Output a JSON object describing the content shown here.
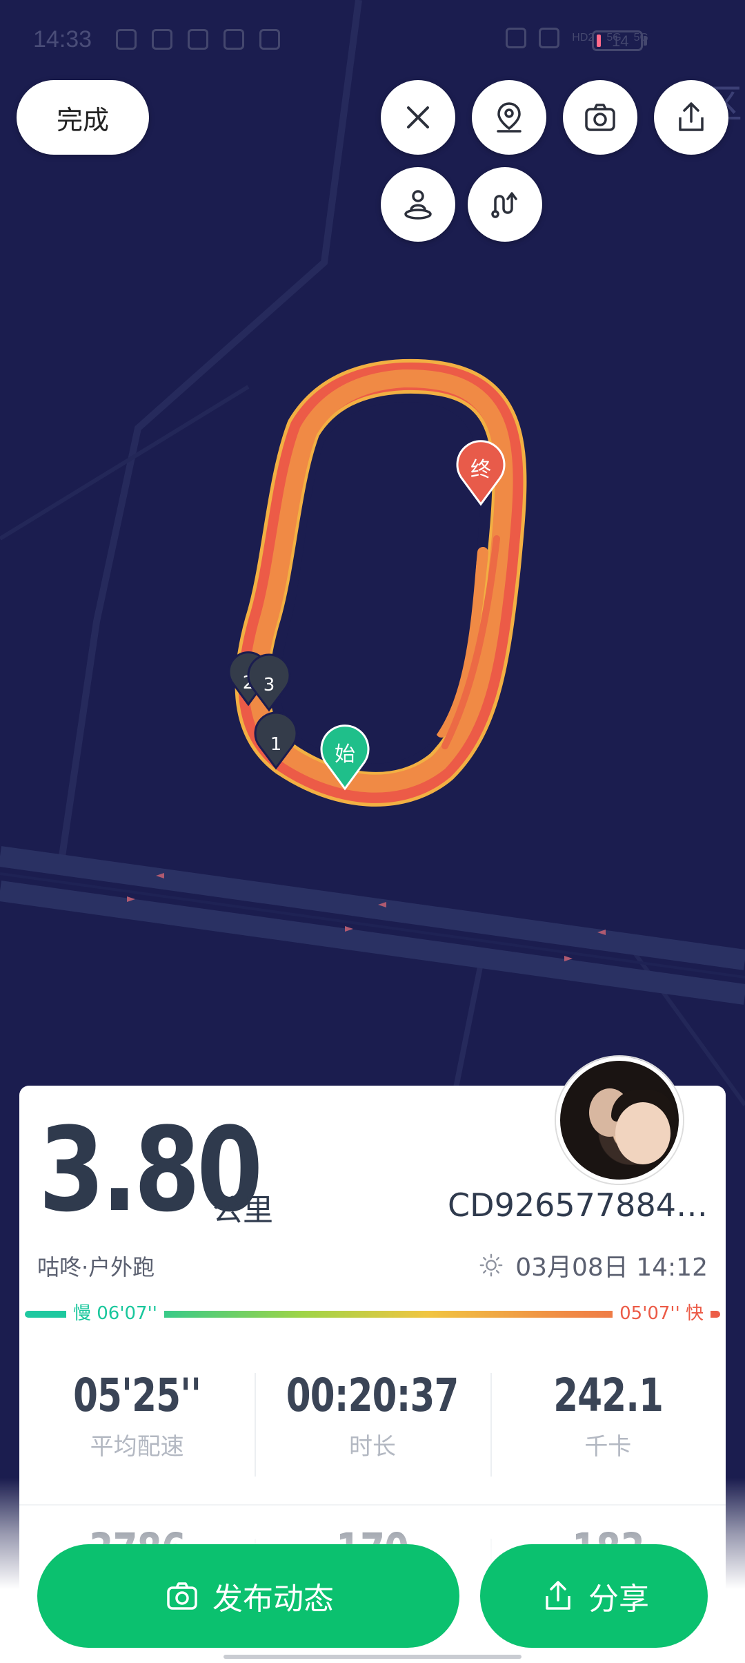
{
  "status_bar": {
    "time": "14:33",
    "network_labels": [
      "HD2",
      "5G",
      "5G"
    ],
    "battery": "14"
  },
  "top_bar": {
    "done_label": "完成"
  },
  "map": {
    "start_marker": "始",
    "end_marker": "终",
    "lap_markers": [
      "1",
      "2",
      "3"
    ],
    "watermark": "区",
    "colors": {
      "background": "#1b1d4f",
      "route": "#f08a45",
      "route_edge": "#ec5b47",
      "start": "#1fbf8a",
      "end": "#e85b4a",
      "lap": "#343c4a"
    }
  },
  "summary": {
    "distance": "3.80",
    "distance_unit": "公里",
    "username": "CD926577884…",
    "sport_type": "咕咚·户外跑",
    "datetime": "03月08日 14:12",
    "weather_icon": "sun-icon"
  },
  "pace_scale": {
    "slow_label": "慢 06'07''",
    "fast_label": "05'07'' 快"
  },
  "stats": [
    {
      "value": "05'25''",
      "label": "平均配速"
    },
    {
      "value": "00:20:37",
      "label": "时长"
    },
    {
      "value": "242.1",
      "label": "千卡"
    }
  ],
  "stats_partial": [
    {
      "value": "3786"
    },
    {
      "value": "170"
    },
    {
      "value": "183"
    }
  ],
  "actions": {
    "post_label": "发布动态",
    "share_label": "分享"
  }
}
